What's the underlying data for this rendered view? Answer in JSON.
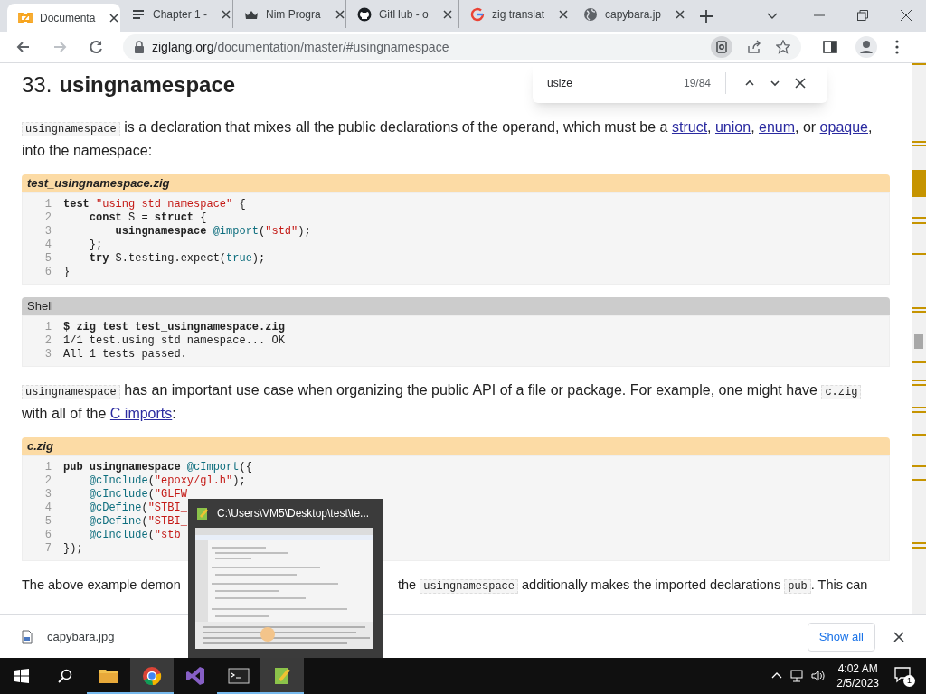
{
  "tabs": [
    {
      "title": "Documenta",
      "kind": "zig",
      "selected": true
    },
    {
      "title": "Chapter 1 -",
      "kind": "doc",
      "selected": false
    },
    {
      "title": "Nim Progra",
      "kind": "nim",
      "selected": false
    },
    {
      "title": "GitHub - o",
      "kind": "github",
      "selected": false
    },
    {
      "title": "zig translat",
      "kind": "google",
      "selected": false
    },
    {
      "title": "capybara.jp",
      "kind": "globe",
      "selected": false
    }
  ],
  "address": {
    "host": "ziglang.org",
    "path": "/documentation/master/#usingnamespace"
  },
  "find_bar": {
    "query": "usize",
    "count": "19/84"
  },
  "heading": {
    "number": "33.",
    "title": "usingnamespace"
  },
  "blocks": [
    {
      "kind": "para",
      "segments": [
        {
          "kind": "code",
          "text": "usingnamespace"
        },
        {
          "kind": "text",
          "text": " is a declaration that mixes all the public declarations of the operand, which must be a "
        },
        {
          "kind": "link",
          "text": "struct"
        },
        {
          "kind": "text",
          "text": ", "
        },
        {
          "kind": "link",
          "text": "union"
        },
        {
          "kind": "text",
          "text": ", "
        },
        {
          "kind": "link",
          "text": "enum"
        },
        {
          "kind": "text",
          "text": ", or "
        },
        {
          "kind": "link",
          "text": "opaque"
        },
        {
          "kind": "text",
          "text": ", into the namespace:"
        }
      ]
    },
    {
      "kind": "file",
      "title": "test_usingnamespace.zig",
      "lines": [
        {
          "num": "1",
          "tokens": [
            {
              "kind": "kw",
              "text": "test"
            },
            {
              "kind": "str",
              "text": " \"using std namespace\""
            },
            {
              "kind": "plain",
              "text": " {"
            }
          ]
        },
        {
          "num": "2",
          "tokens": [
            {
              "kind": "kw",
              "text": "    const"
            },
            {
              "kind": "plain",
              "text": " S = "
            },
            {
              "kind": "kw",
              "text": "struct"
            },
            {
              "kind": "plain",
              "text": " {"
            }
          ]
        },
        {
          "num": "3",
          "tokens": [
            {
              "kind": "kw",
              "text": "        usingnamespace"
            },
            {
              "kind": "builtin",
              "text": " @import"
            },
            {
              "kind": "plain",
              "text": "("
            },
            {
              "kind": "str",
              "text": "\"std\""
            },
            {
              "kind": "plain",
              "text": ");"
            }
          ]
        },
        {
          "num": "4",
          "tokens": [
            {
              "kind": "plain",
              "text": "    };"
            }
          ]
        },
        {
          "num": "5",
          "tokens": [
            {
              "kind": "kw",
              "text": "    try"
            },
            {
              "kind": "plain",
              "text": " S.testing.expect("
            },
            {
              "kind": "builtin",
              "text": "true"
            },
            {
              "kind": "plain",
              "text": ");"
            }
          ]
        },
        {
          "num": "6",
          "tokens": [
            {
              "kind": "plain",
              "text": "}"
            }
          ]
        }
      ]
    },
    {
      "kind": "shell",
      "title": "Shell",
      "lines": [
        {
          "num": "1",
          "tokens": [
            {
              "kind": "kw",
              "text": "$ zig test test_usingnamespace.zig"
            }
          ]
        },
        {
          "num": "2",
          "tokens": [
            {
              "kind": "plain",
              "text": "1/1 test.using std namespace... OK"
            }
          ]
        },
        {
          "num": "3",
          "tokens": [
            {
              "kind": "plain",
              "text": "All 1 tests passed."
            }
          ]
        }
      ]
    },
    {
      "kind": "para",
      "segments": [
        {
          "kind": "code",
          "text": "usingnamespace"
        },
        {
          "kind": "text",
          "text": " has an important use case when organizing the public API of a file or package. For example, one might have "
        },
        {
          "kind": "code",
          "text": "c.zig"
        },
        {
          "kind": "text",
          "text": " with all of the "
        },
        {
          "kind": "link",
          "text": "C imports"
        },
        {
          "kind": "text",
          "text": ":"
        }
      ]
    },
    {
      "kind": "file",
      "title": "c.zig",
      "lines": [
        {
          "num": "1",
          "tokens": [
            {
              "kind": "kw",
              "text": "pub"
            },
            {
              "kind": "kw",
              "text": " usingnamespace"
            },
            {
              "kind": "builtin",
              "text": " @cImport"
            },
            {
              "kind": "plain",
              "text": "({"
            }
          ]
        },
        {
          "num": "2",
          "tokens": [
            {
              "kind": "builtin",
              "text": "    @cInclude"
            },
            {
              "kind": "plain",
              "text": "("
            },
            {
              "kind": "str",
              "text": "\"epoxy/gl.h\""
            },
            {
              "kind": "plain",
              "text": ");"
            }
          ]
        },
        {
          "num": "3",
          "tokens": [
            {
              "kind": "builtin",
              "text": "    @cInclude"
            },
            {
              "kind": "plain",
              "text": "("
            },
            {
              "kind": "str",
              "text": "\"GLFW"
            }
          ]
        },
        {
          "num": "4",
          "tokens": [
            {
              "kind": "builtin",
              "text": "    @cDefine"
            },
            {
              "kind": "plain",
              "text": "("
            },
            {
              "kind": "str",
              "text": "\"STBI_"
            }
          ]
        },
        {
          "num": "5",
          "tokens": [
            {
              "kind": "builtin",
              "text": "    @cDefine"
            },
            {
              "kind": "plain",
              "text": "("
            },
            {
              "kind": "str",
              "text": "\"STBI_"
            }
          ]
        },
        {
          "num": "6",
          "tokens": [
            {
              "kind": "builtin",
              "text": "    @cInclude"
            },
            {
              "kind": "plain",
              "text": "("
            },
            {
              "kind": "str",
              "text": "\"stb_"
            }
          ]
        },
        {
          "num": "7",
          "tokens": [
            {
              "kind": "plain",
              "text": "});"
            }
          ]
        }
      ]
    },
    {
      "kind": "split_para",
      "left": [
        {
          "kind": "text",
          "text": "The above example demon"
        }
      ],
      "right": [
        {
          "kind": "text",
          "text": "the "
        },
        {
          "kind": "code",
          "text": "usingnamespace"
        },
        {
          "kind": "text",
          "text": " additionally makes the imported declarations "
        },
        {
          "kind": "code",
          "text": "pub"
        },
        {
          "kind": "text",
          "text": ". This can"
        }
      ]
    }
  ],
  "preview": {
    "title": "C:\\Users\\VM5\\Desktop\\test\\te..."
  },
  "download": {
    "file": "capybara.jpg",
    "button": "Show all"
  },
  "taskbar": {
    "apps": [
      {
        "kind": "folder",
        "running": true,
        "selected": false
      },
      {
        "kind": "chrome",
        "running": true,
        "selected": true
      },
      {
        "kind": "vs",
        "running": false,
        "selected": false
      },
      {
        "kind": "terminal",
        "running": true,
        "selected": false
      },
      {
        "kind": "notepad",
        "running": true,
        "selected": true
      }
    ],
    "time": "4:02 AM",
    "date": "2/5/2023",
    "notifications": "1"
  }
}
